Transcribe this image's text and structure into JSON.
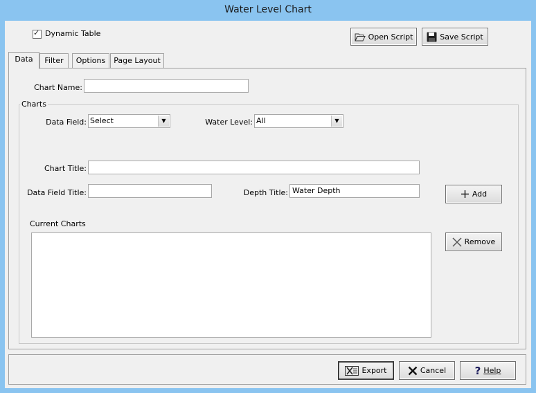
{
  "window": {
    "title": "Water Level Chart"
  },
  "top": {
    "dynamic_table_label": "Dynamic Table",
    "dynamic_table_checked": true,
    "open_script_label": "Open Script",
    "save_script_label": "Save Script"
  },
  "tabs": [
    {
      "label": "Data",
      "active": true
    },
    {
      "label": "Filter",
      "active": false
    },
    {
      "label": "Options",
      "active": false
    },
    {
      "label": "Page Layout",
      "active": false
    }
  ],
  "form": {
    "chart_name_label": "Chart Name:",
    "chart_name_value": "",
    "charts_group_label": "Charts",
    "data_field_label": "Data Field:",
    "data_field_value": "Select",
    "water_level_label": "Water Level:",
    "water_level_value": "All",
    "chart_title_label": "Chart Title:",
    "chart_title_value": "",
    "data_field_title_label": "Data Field Title:",
    "data_field_title_value": "",
    "depth_title_label": "Depth Title:",
    "depth_title_value": "Water Depth",
    "add_label": "Add",
    "current_charts_label": "Current Charts",
    "remove_label": "Remove"
  },
  "footer": {
    "export_label": "Export",
    "cancel_label": "Cancel",
    "help_label": "Help"
  },
  "icons": [
    "folder-open-icon",
    "floppy-disk-icon",
    "plus-icon",
    "x-icon",
    "export-icon",
    "cancel-x-icon",
    "help-question-icon"
  ]
}
